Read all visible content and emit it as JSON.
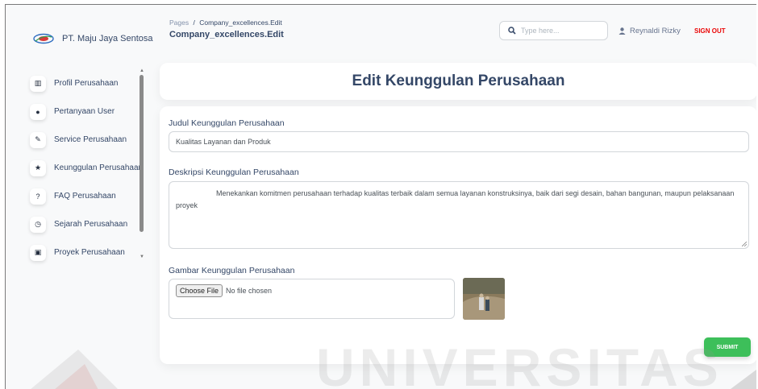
{
  "brand": {
    "name": "PT. Maju Jaya Sentosa"
  },
  "sidebar": {
    "items": [
      {
        "label": "Profil Perusahaan",
        "icon": "building-icon"
      },
      {
        "label": "Pertanyaan User",
        "icon": "info-circle-icon"
      },
      {
        "label": "Service Perusahaan",
        "icon": "wrench-icon"
      },
      {
        "label": "Keunggulan Perusahaan",
        "icon": "star-icon"
      },
      {
        "label": "FAQ Perusahaan",
        "icon": "question-circle-icon"
      },
      {
        "label": "Sejarah Perusahaan",
        "icon": "clock-icon"
      },
      {
        "label": "Proyek Perusahaan",
        "icon": "briefcase-icon"
      }
    ]
  },
  "header": {
    "breadcrumb_root": "Pages",
    "breadcrumb_sep": "/",
    "breadcrumb_current": "Company_excellences.Edit",
    "title": "Company_excellences.Edit",
    "search_placeholder": "Type here...",
    "user_name": "Reynaldi Rizky",
    "signout_label": "SIGN OUT"
  },
  "form": {
    "heading": "Edit Keunggulan Perusahaan",
    "title_label": "Judul Keunggulan Perusahaan",
    "title_value": "Kualitas Layanan dan Produk",
    "desc_label": "Deskripsi Keunggulan Perusahaan",
    "desc_value": "Menekankan komitmen perusahaan terhadap kualitas terbaik dalam semua layanan konstruksinya, baik dari segi desain, bahan bangunan, maupun pelaksanaan proyek",
    "image_label": "Gambar Keunggulan Perusahaan",
    "choose_file_label": "Choose File",
    "no_file_label": "No file chosen",
    "submit_label": "SUBMIT"
  },
  "watermark": {
    "text": "UNIVERSITAS"
  },
  "colors": {
    "accent": "#3dbf5a",
    "danger": "#ea0606",
    "text": "#344767"
  }
}
